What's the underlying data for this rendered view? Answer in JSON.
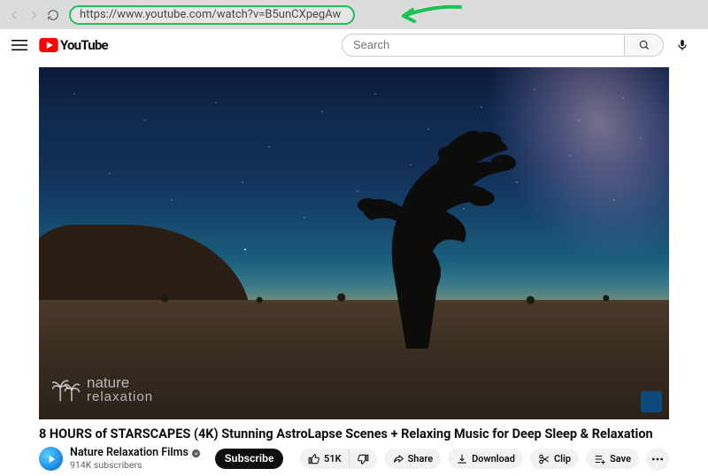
{
  "browser": {
    "url": "https://www.youtube.com/watch?v=B5unCXpegAw"
  },
  "logo_text": "YouTube",
  "search": {
    "placeholder": "Search"
  },
  "video": {
    "title": "8 HOURS of STARSCAPES (4K) Stunning AstroLapse Scenes + Relaxing Music for Deep Sleep & Relaxation",
    "watermark_line1": "nature",
    "watermark_line2": "relaxation"
  },
  "channel": {
    "name": "Nature Relaxation Films",
    "subscribers": "914K subscribers"
  },
  "actions": {
    "subscribe": "Subscribe",
    "likes": "51K",
    "share": "Share",
    "download": "Download",
    "clip": "Clip",
    "save": "Save"
  }
}
